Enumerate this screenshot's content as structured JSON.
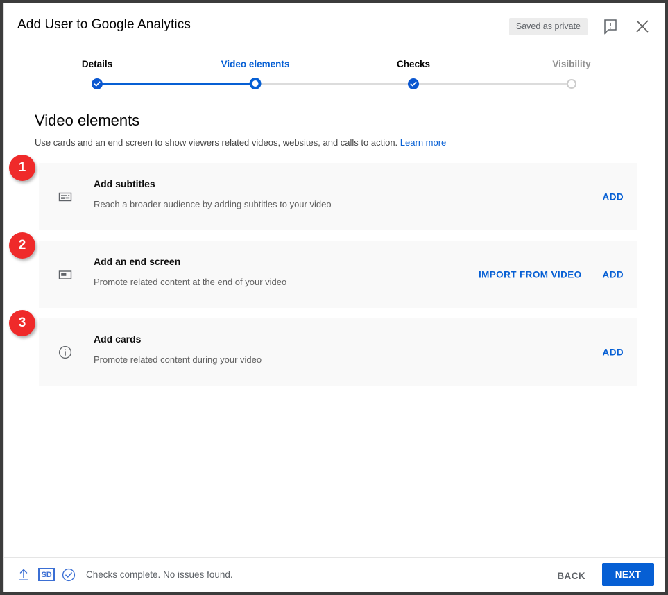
{
  "window": {
    "title": "Add User to Google Analytics",
    "status_badge": "Saved as private",
    "report_icon": "report-feedback-icon",
    "close_icon": "close-icon"
  },
  "stepper": {
    "steps": [
      {
        "label": "Details",
        "state": "done"
      },
      {
        "label": "Video elements",
        "state": "current"
      },
      {
        "label": "Checks",
        "state": "done"
      },
      {
        "label": "Visibility",
        "state": "todo"
      }
    ]
  },
  "main": {
    "title": "Video elements",
    "description": "Use cards and an end screen to show viewers related videos, websites, and calls to action.",
    "learn_more": "Learn more",
    "cards": [
      {
        "icon": "subtitles-icon",
        "title": "Add subtitles",
        "subtitle": "Reach a broader audience by adding subtitles to your video",
        "actions": [
          "ADD"
        ],
        "annotation": "1"
      },
      {
        "icon": "end-screen-icon",
        "title": "Add an end screen",
        "subtitle": "Promote related content at the end of your video",
        "actions": [
          "IMPORT FROM VIDEO",
          "ADD"
        ],
        "annotation": "2"
      },
      {
        "icon": "info-circle-icon",
        "title": "Add cards",
        "subtitle": "Promote related content during your video",
        "actions": [
          "ADD"
        ],
        "annotation": "3"
      }
    ]
  },
  "footer": {
    "upload_icon": "upload-arrow-icon",
    "quality_badge": "SD",
    "checks_icon": "check-circle-icon",
    "checks_text": "Checks complete. No issues found.",
    "back_label": "BACK",
    "next_label": "NEXT"
  },
  "colors": {
    "accent_blue": "#065fd4",
    "step_done_blue": "#0b57d0",
    "annotation_red": "#ef2a2a",
    "card_bg": "#f9f9f9",
    "muted_text": "#5f6368"
  }
}
